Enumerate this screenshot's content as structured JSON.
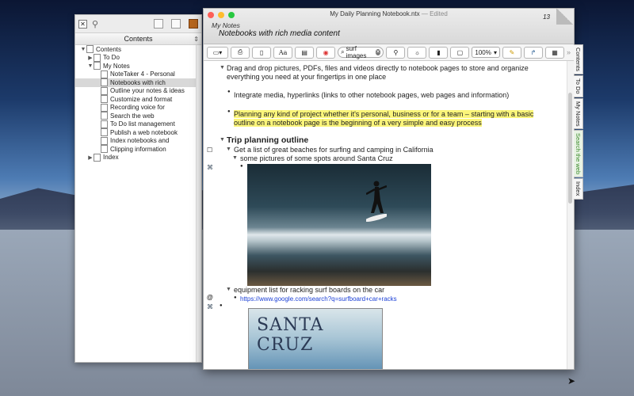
{
  "panel": {
    "header": "Contents",
    "tree": [
      {
        "label": "Contents",
        "level": 0,
        "tri": "▼"
      },
      {
        "label": "To Do",
        "level": 1,
        "tri": "▶"
      },
      {
        "label": "My Notes",
        "level": 1,
        "tri": "▼"
      },
      {
        "label": "NoteTaker 4 - Personal",
        "level": 2
      },
      {
        "label": "Notebooks with rich",
        "level": 2,
        "selected": true
      },
      {
        "label": "Outline your notes & ideas",
        "level": 2
      },
      {
        "label": "Customize  and format",
        "level": 2
      },
      {
        "label": "Recording voice for",
        "level": 2
      },
      {
        "label": "Search the web",
        "level": 2
      },
      {
        "label": "To Do list management",
        "level": 2
      },
      {
        "label": "Publish a web notebook",
        "level": 2
      },
      {
        "label": "Index notebooks and",
        "level": 2
      },
      {
        "label": "Clipping information",
        "level": 2
      },
      {
        "label": "Index",
        "level": 1,
        "tri": "▶"
      }
    ]
  },
  "window": {
    "title": "My Daily Planning Notebook.ntx",
    "edited": "— Edited",
    "notebook": "My Notes",
    "page": "Notebooks with rich media content",
    "page_number": "13"
  },
  "toolbar": {
    "search_value": "surf images",
    "zoom": "100%",
    "font_label": "Aa"
  },
  "content": {
    "item1": "Drag and drop pictures, PDFs, files and videos directly to notebook pages to store and organize",
    "item1b": "everything you need at your fingertips in one place",
    "item2": "Integrate media, hyperlinks (links to other notebook pages, web pages and information)",
    "item3a": "Planning any kind of project whether it's personal, business or for a team – starting with a basic",
    "item3b": "outline on a notebook page is the beginning of a very simple and easy process",
    "heading": "Trip planning outline",
    "task1": "Get a list of great beaches for surfing and camping in California",
    "sub1": "some pictures of some spots around Santa Cruz",
    "sub2": "equipment list for racking surf boards on the car",
    "link": "https://www.google.com/search?q=surfboard+car+racks",
    "poster_text": "SANTA CRUZ"
  },
  "tabs": [
    {
      "label": "Contents"
    },
    {
      "label": "To Do"
    },
    {
      "label": "My Notes"
    },
    {
      "label": "Search the web",
      "green": true
    },
    {
      "label": "Index"
    }
  ],
  "colors": {
    "highlight": "#fbf57a",
    "link": "#1a3fd6"
  }
}
